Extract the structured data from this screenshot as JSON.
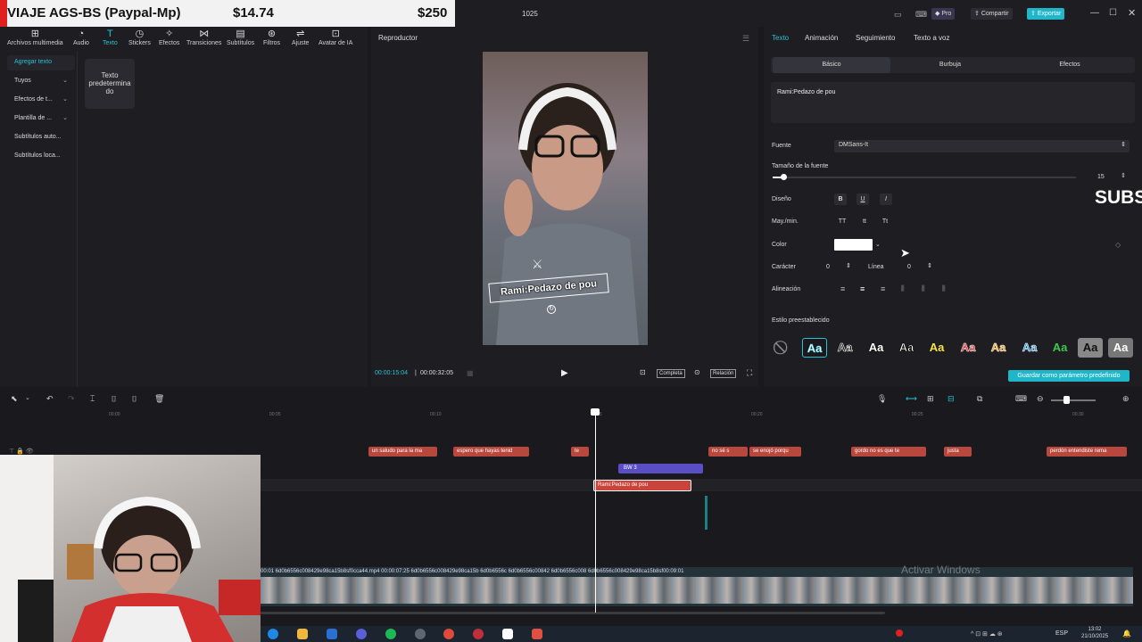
{
  "donation": {
    "text": "VIAJE AGS-BS (Paypal-Mp)",
    "amount1": "$14.74",
    "amount2": "$250"
  },
  "titlebar": {
    "project_name": "1025",
    "pro_label": "Pro",
    "share_label": "Compartir",
    "export_label": "Exportar"
  },
  "toolbar": {
    "items": [
      {
        "icon": "media-icon",
        "label": "Archivos multimedia"
      },
      {
        "icon": "audio-icon",
        "label": "Audio"
      },
      {
        "icon": "text-icon",
        "label": "Texto"
      },
      {
        "icon": "stickers-icon",
        "label": "Stickers"
      },
      {
        "icon": "effects-icon",
        "label": "Efectos"
      },
      {
        "icon": "transitions-icon",
        "label": "Transiciones"
      },
      {
        "icon": "subtitles-icon",
        "label": "Subtítulos"
      },
      {
        "icon": "filters-icon",
        "label": "Filtros"
      },
      {
        "icon": "adjust-icon",
        "label": "Ajuste"
      },
      {
        "icon": "ai-avatar-icon",
        "label": "Avatar de IA"
      }
    ]
  },
  "sidebar": {
    "items": [
      {
        "label": "Agregar texto"
      },
      {
        "label": "Tuyos"
      },
      {
        "label": "Efectos de t..."
      },
      {
        "label": "Plantilla de ..."
      },
      {
        "label": "Subtítulos auto..."
      },
      {
        "label": "Subtítulos loca..."
      }
    ]
  },
  "text_card": {
    "label": "Texto predetermina do"
  },
  "player": {
    "title": "Reproductor",
    "caption": "Rami:Pedazo de pou",
    "current_time": "00:00:15:04",
    "total_time": "00:00:32:05",
    "full_label": "Completa",
    "ratio_label": "Relación"
  },
  "right_panel": {
    "tabs": [
      "Texto",
      "Animación",
      "Seguimiento",
      "Texto a voz"
    ],
    "subtabs": [
      "Básico",
      "Burbuja",
      "Efectos"
    ],
    "text_value": "Rami:Pedazo de pou",
    "font_label": "Fuente",
    "font_value": "DMSans-It",
    "size_label": "Tamaño de la fuente",
    "size_value": "15",
    "size_fraction": 0.03,
    "design_label": "Diseño",
    "design_buttons": [
      "B",
      "U",
      "I"
    ],
    "case_label": "May./min.",
    "case_buttons": [
      "TT",
      "tt",
      "Tt"
    ],
    "color_label": "Color",
    "color_value": "#ffffff",
    "char_label": "Carácter",
    "char_value": "0",
    "line_label": "Línea",
    "line_value": "0",
    "align_label": "Alineación",
    "preset_label": "Estilo preestablecido",
    "preset_text": "Aa",
    "save_preset": "Guardar como parámetro predefinido",
    "subs_overlay": "SUBS"
  },
  "timeline": {
    "ruler": [
      "00:00",
      "00:05",
      "00:10",
      "00:15",
      "00:20",
      "00:25",
      "00:30"
    ],
    "text_clips": [
      {
        "label": "un saludo para la ma"
      },
      {
        "label": "espero que hayas tenid"
      },
      {
        "label": "te"
      },
      {
        "label": "no sé s"
      },
      {
        "label": "se enojó porqu"
      },
      {
        "label": "gordo no es que te"
      },
      {
        "label": "justa"
      },
      {
        "label": "perdón entendiste rema"
      }
    ],
    "bw_clip": "BW 3",
    "selected_clip": "Rami:Pedazo de pou",
    "video_label": "00:01   6d0b6556c008429e98ca15b8sf0cca44.mp4   00:00:07:25   6d0b6556c008429e98ca15b   6d0b6556c   6d0b6556c00842   6d0b6556c008   6d0b6556c008429e98ca15b8sf00:09:01",
    "watermark": "Activar Windows"
  },
  "taskbar": {
    "lang": "ESP",
    "time": "13:02",
    "date": "21/10/2025"
  },
  "colors": {
    "accent": "#27c2d6",
    "text_clip": "#b8483e",
    "bw_clip": "#5a4ec6"
  }
}
